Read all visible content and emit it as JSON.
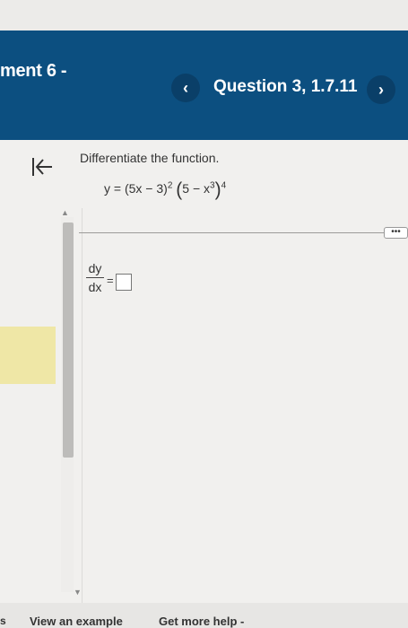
{
  "header": {
    "assignment_title": "ment 6 -",
    "question_label": "Question 3, 1.7.11",
    "prev_icon": "chevron-left-icon",
    "next_icon": "chevron-right-icon",
    "prev_glyph": "‹",
    "next_glyph": "›"
  },
  "question": {
    "prompt": "Differentiate the function.",
    "equation": {
      "lhs": "y = (5x − 3)",
      "exp1": "2",
      "open_paren": "(",
      "inner": "5 − x",
      "inner_exp": "3",
      "close_paren": ")",
      "exp2": "4"
    },
    "answer_lhs_num": "dy",
    "answer_lhs_den": "dx",
    "equals": "=",
    "answer_value": "",
    "more_label": "•••"
  },
  "footer": {
    "left_fragment": "s",
    "view_example": "View an example",
    "get_more_help": "Get more help -"
  },
  "colors": {
    "header_bg": "#0c4f80",
    "nav_button_bg": "#0a3f68",
    "highlight": "#efe7a6"
  }
}
